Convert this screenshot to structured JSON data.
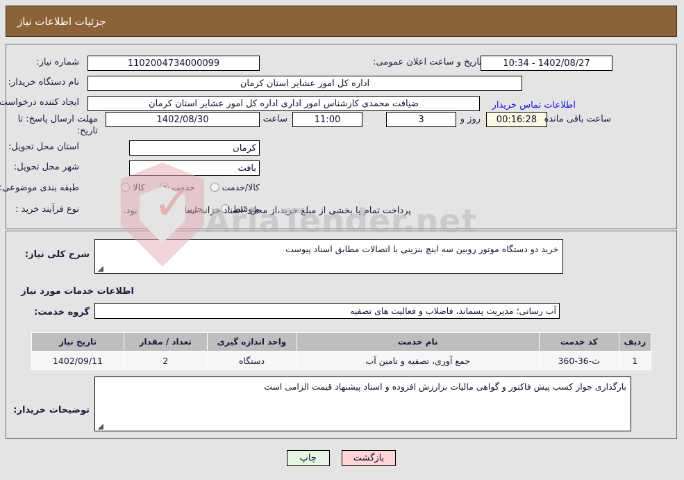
{
  "header": {
    "title": "جزئیات اطلاعات نیاز"
  },
  "form": {
    "need_number": {
      "label": "شماره نیاز:",
      "value": "1102004734000099"
    },
    "announce_datetime": {
      "label": "تاریخ و ساعت اعلان عمومی:",
      "value": "1402/08/27 - 10:34"
    },
    "buyer_org": {
      "label": "نام دستگاه خریدار:",
      "value": "اداره کل امور عشایر استان کرمان"
    },
    "creator": {
      "label": "ایجاد کننده درخواست:",
      "value": "ضیافت محمدی کارشناس امور اداری اداره کل امور عشایر استان کرمان"
    },
    "contact_link": {
      "label": "اطلاعات تماس خریدار"
    },
    "deadline": {
      "label": "مهلت ارسال پاسخ: تا تاریخ:",
      "date": "1402/08/30",
      "time_label": "ساعت",
      "time": "11:00",
      "days": "3",
      "days_label": "روز و",
      "countdown": "00:16:28",
      "remaining_label": "ساعت باقی مانده"
    },
    "delivery_province": {
      "label": "استان محل تحویل:",
      "value": "کرمان"
    },
    "delivery_city": {
      "label": "شهر محل تحویل:",
      "value": "بافت"
    },
    "category": {
      "label": "طبقه بندی موضوعی:",
      "options": [
        "کالا",
        "خدمت",
        "کالا/خدمت"
      ],
      "selected": "خدمت"
    },
    "purchase_type": {
      "label": "نوع فرآیند خرید :",
      "options": [
        "جزیی",
        "متوسط"
      ],
      "selected": "جزیی",
      "note": "پرداخت تمام یا بخشی از مبلغ خرید،از محل \"اسناد خزانه اسلامی\" خواهد بود."
    }
  },
  "main": {
    "general_desc": {
      "label": "شرح کلی نیاز:",
      "value": "خرید دو دستگاه موتور روبین سه اینچ بنزینی با اتصالات مطابق اسناد پیوست"
    },
    "services_section_title": "اطلاعات خدمات مورد نیاز",
    "service_group": {
      "label": "گروه خدمت:",
      "value": "آب رسانی؛ مدیریت پسماند، فاضلاب و فعالیت های تصفیه"
    },
    "table": {
      "columns": [
        "ردیف",
        "کد خدمت",
        "نام خدمت",
        "واحد اندازه گیری",
        "تعداد / مقدار",
        "تاریخ نیاز"
      ],
      "rows": [
        {
          "row_no": "1",
          "service_code": "ث-36-360",
          "service_name": "جمع آوری، تصفیه و تامین آب",
          "unit": "دستگاه",
          "quantity": "2",
          "need_date": "1402/09/11"
        }
      ]
    },
    "buyer_notes": {
      "label": "توضیحات خریدار:",
      "value": "بارگذاری جواز کسب پیش فاکتور و گواهی مالیات برارزش افزوده  و اسناد پیشنهاد قیمت الزامی است"
    }
  },
  "footer": {
    "back_button": "بازگشت",
    "print_button": "چاپ"
  },
  "watermark": {
    "text": "AriaTender.net"
  },
  "colors": {
    "header_bg": "#8c6239",
    "link": "#1515ee",
    "back_btn_bg": "#ffd5d5",
    "print_btn_bg": "#e6f5e1",
    "timer_bg": "#fbfbe4",
    "table_header_bg": "#bebebe"
  }
}
